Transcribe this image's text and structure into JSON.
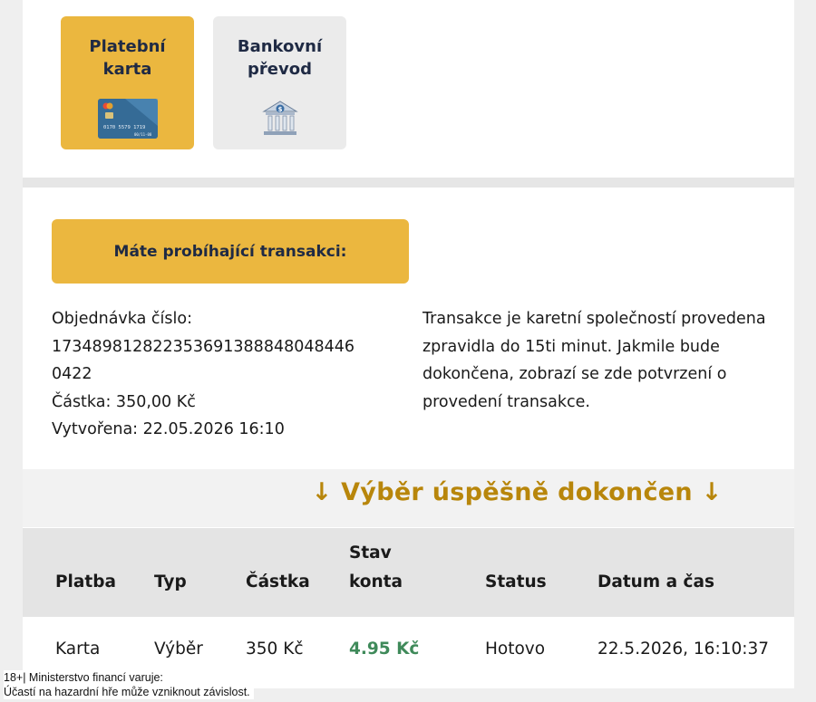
{
  "payment_methods": [
    {
      "label_line1": "Platební",
      "label_line2": "karta",
      "icon": "credit-card-icon",
      "active": true
    },
    {
      "label_line1": "Bankovní",
      "label_line2": "převod",
      "icon": "bank-icon",
      "active": false
    }
  ],
  "card_icon": {
    "number": "0170 5579 1719",
    "expiry": "00/11-00"
  },
  "pending": {
    "banner": "Máte probíhající transakci:",
    "order_label": "Objednávka číslo:",
    "order_number": "17348981282235369138884804844604 22",
    "order_number_line1": "173489812822353691388848048446",
    "order_number_line2": "0422",
    "amount": "Částka: 350,00 Kč",
    "created": "Vytvořena: 22.05.2026 16:10",
    "note": "Transakce je karetní společností provedena zpravidla do 15ti minut. Jakmile bude dokončena, zobrazí se zde potvrzení o provedení transakce."
  },
  "success_heading": "↓ Výběr úspěšně dokončen ↓",
  "table": {
    "headers": {
      "platba": "Platba",
      "typ": "Typ",
      "castka": "Částka",
      "stav_line1": "Stav",
      "stav_line2": "konta",
      "status": "Status",
      "datum": "Datum a čas"
    },
    "rows": [
      {
        "platba": "Karta",
        "typ": "Výběr",
        "castka": "350 Kč",
        "stav": "4.95 Kč",
        "status": "Hotovo",
        "datum": "22.5.2026, 16:10:37"
      }
    ]
  },
  "colors": {
    "accent": "#ebb73f",
    "success": "#b8860b",
    "balance": "#3f8a5a"
  },
  "warning": {
    "line1": "18+| Ministerstvo financí varuje:",
    "line2": "Účastí na hazardní hře může vzniknout závislost."
  }
}
